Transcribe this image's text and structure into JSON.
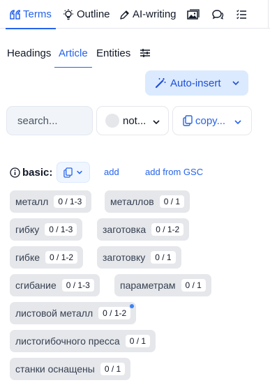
{
  "top_tabs": [
    {
      "label": "Terms",
      "icon": "quote-icon",
      "active": true
    },
    {
      "label": "Outline",
      "icon": "lightbulb-icon"
    },
    {
      "label": "AI-writing",
      "icon": "pen-icon"
    },
    {
      "label": "",
      "icon": "images-icon"
    },
    {
      "label": "",
      "icon": "chat-icon"
    },
    {
      "label": "",
      "icon": "list-icon"
    }
  ],
  "sub_tabs": [
    {
      "label": "Headings"
    },
    {
      "label": "Article",
      "active": true
    },
    {
      "label": "Entities"
    }
  ],
  "auto_insert": {
    "label": "Auto-insert"
  },
  "filters": {
    "search_placeholder": "search...",
    "status_label": "not...",
    "copy_label": "copy..."
  },
  "basic": {
    "label": "basic:",
    "add_label": "add",
    "add_gsc_label": "add from GSC"
  },
  "terms": [
    {
      "term": "металл",
      "count": "0 / 1-3"
    },
    {
      "term": "металлов",
      "count": "0 / 1"
    },
    {
      "term": "гибку",
      "count": "0 / 1-3"
    },
    {
      "term": "заготовка",
      "count": "0 / 1-2"
    },
    {
      "term": "гибке",
      "count": "0 / 1-2"
    },
    {
      "term": "заготовку",
      "count": "0 / 1"
    },
    {
      "term": "сгибание",
      "count": "0 / 1-3"
    },
    {
      "term": "параметрам",
      "count": "0 / 1"
    },
    {
      "term": "листовой металл",
      "count": "0 / 1-2",
      "dot": true
    },
    {
      "term": "листогибочного пресса",
      "count": "0 / 1"
    },
    {
      "term": "станки оснащены",
      "count": "0 / 1"
    }
  ],
  "colors": {
    "accent": "#2563eb",
    "chip_bg": "#e5e7eb",
    "auto_insert_bg": "#dbeafe"
  }
}
